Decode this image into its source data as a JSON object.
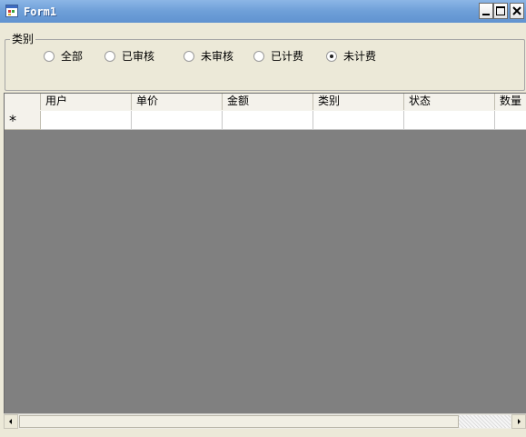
{
  "window": {
    "title": "Form1",
    "icon": "form-app-icon"
  },
  "caption_buttons": [
    "minimize-icon",
    "maximize-icon",
    "close-icon"
  ],
  "filter_group": {
    "legend": "类别",
    "options": [
      {
        "label": "全部",
        "selected": false
      },
      {
        "label": "已审核",
        "selected": false
      },
      {
        "label": "未审核",
        "selected": false
      },
      {
        "label": "已计费",
        "selected": false
      },
      {
        "label": "未计费",
        "selected": true
      }
    ]
  },
  "grid": {
    "columns": [
      "用户",
      "单价",
      "金额",
      "类别",
      "状态",
      "数量"
    ],
    "new_row_marker": "*",
    "rows": []
  }
}
